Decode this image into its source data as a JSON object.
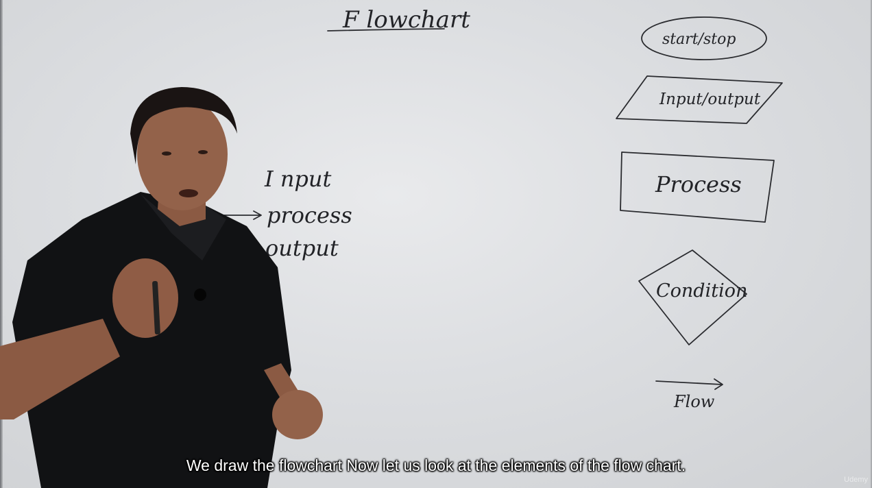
{
  "board": {
    "title": "F lowchart",
    "left_list": [
      "I nput",
      "process",
      "output"
    ],
    "shapes": {
      "terminator": "start/stop",
      "io": "Input/output",
      "process": "Process",
      "decision": "Condition",
      "flow": "Flow"
    }
  },
  "subtitle": "We draw the flowchart Now let us look at the elements of the flow chart.",
  "watermark": "Udemy",
  "colors": {
    "board": "#dcdee1",
    "ink": "#222327",
    "shirt": "#111214",
    "skin": "#8a5a44"
  }
}
